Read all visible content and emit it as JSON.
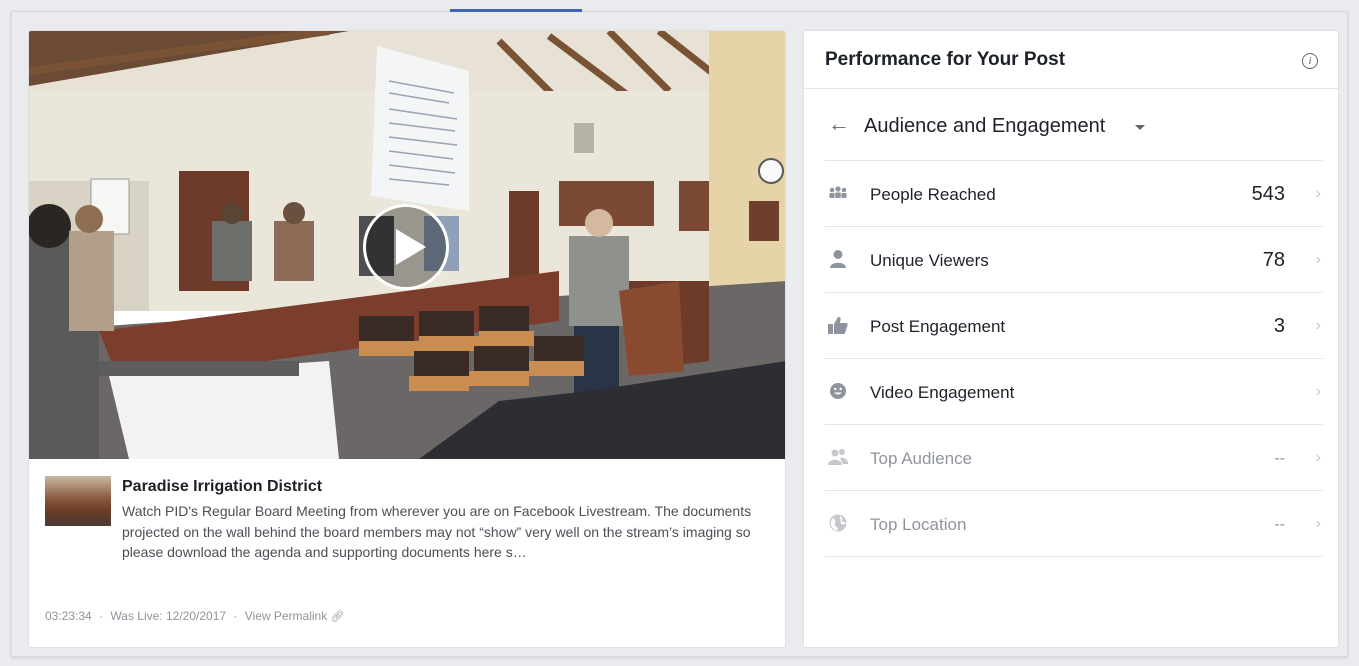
{
  "post": {
    "page_name": "Paradise Irrigation District",
    "description": "Watch PID's Regular Board Meeting from wherever you are on Facebook Livestream. The documents projected on the wall behind the board members may not “show” very well on the stream’s imaging so please download the agenda and supporting documents here s…",
    "duration": "03:23:34",
    "separator": "·",
    "live_date": "Was Live: 12/20/2017",
    "permalink_label": "View Permalink"
  },
  "performance": {
    "title": "Performance for Your Post",
    "section": "Audience and Engagement",
    "metrics": [
      {
        "label": "People Reached",
        "value": "543",
        "icon": "people-icon"
      },
      {
        "label": "Unique Viewers",
        "value": "78",
        "icon": "person-icon"
      },
      {
        "label": "Post Engagement",
        "value": "3",
        "icon": "thumbs-up-icon"
      },
      {
        "label": "Video Engagement",
        "value": "",
        "icon": "smiley-icon"
      },
      {
        "label": "Top Audience",
        "value": "--",
        "icon": "audience-icon"
      },
      {
        "label": "Top Location",
        "value": "--",
        "icon": "globe-icon"
      }
    ]
  },
  "colors": {
    "accent": "#4267b2",
    "text_primary": "#1d2129",
    "text_secondary": "#90949c",
    "background": "#e9ebee"
  }
}
